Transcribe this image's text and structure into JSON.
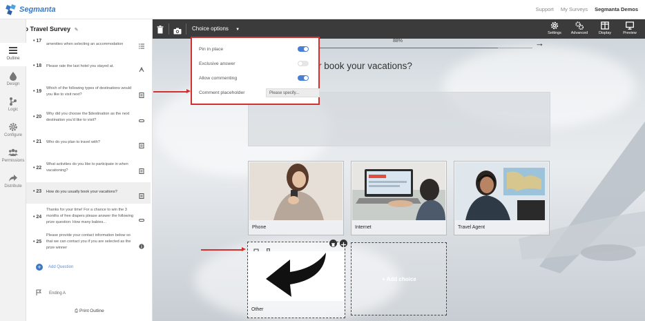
{
  "app": {
    "logo_text": "Segmanta",
    "nav": {
      "support": "Support",
      "my_surveys": "My Surveys",
      "account": "Segmanta Demos"
    }
  },
  "rail": [
    {
      "label": "Outline",
      "icon": "list-icon",
      "active": true
    },
    {
      "label": "Design",
      "icon": "drop-icon",
      "active": false
    },
    {
      "label": "Logic",
      "icon": "branch-icon",
      "active": false
    },
    {
      "label": "Configure",
      "icon": "gear-icon",
      "active": false
    },
    {
      "label": "Permissions",
      "icon": "users-icon",
      "active": false
    },
    {
      "label": "Distribute",
      "icon": "share-icon",
      "active": false
    }
  ],
  "outline": {
    "survey_title": "Demo Travel Survey",
    "questions": [
      {
        "num": "17",
        "text": "amenities when selecting an accommodation",
        "icon": "list-icon"
      },
      {
        "num": "18",
        "text": "Please rate the last hotel you stayed at.",
        "icon": "rating-icon"
      },
      {
        "num": "19",
        "text": "Which of the following types of destinations would you like to visit next?",
        "icon": "choice-icon"
      },
      {
        "num": "20",
        "text": "Why did you choose the $destination as the next destination you'd like to visit?",
        "icon": "text-icon"
      },
      {
        "num": "21",
        "text": "Who do you plan to travel with?",
        "icon": "choice-icon"
      },
      {
        "num": "22",
        "text": "What activities do you like to participate in when vacationing?",
        "icon": "choice-icon"
      },
      {
        "num": "23",
        "text": "How do you usually book your vacations?",
        "icon": "choice-icon",
        "active": true
      },
      {
        "num": "24",
        "text": "Thanks for your time! For a chance to win the 3 months of free diapers please answer the following prize question: How many babies...",
        "icon": "text-icon"
      },
      {
        "num": "25",
        "text": "Please provide your contact information below so that we can contact you if you are selected as the prize winner",
        "icon": "info-icon"
      }
    ],
    "add_question": "Add Question",
    "ending": "Ending A",
    "print_outline": "Print Outline"
  },
  "toolbar": {
    "choice_options": "Choice options",
    "right_buttons": [
      {
        "label": "Settings",
        "icon": "gear-icon"
      },
      {
        "label": "Advanced",
        "icon": "gears-icon"
      },
      {
        "label": "Display",
        "icon": "layout-icon"
      },
      {
        "label": "Preview",
        "icon": "monitor-icon"
      }
    ]
  },
  "canvas": {
    "progress_text": "88%",
    "progress": 0.88,
    "question_visible_text": "r book your vacations?",
    "choices": [
      {
        "label": "Phone"
      },
      {
        "label": "Internet"
      },
      {
        "label": "Travel Agent"
      },
      {
        "label": "Other"
      }
    ],
    "add_choice": "+ Add choice"
  },
  "popup": {
    "options": [
      {
        "label": "Pin in place",
        "on": true
      },
      {
        "label": "Exclusive answer",
        "on": false
      },
      {
        "label": "Allow commenting",
        "on": true
      }
    ],
    "comment_placeholder_label": "Comment placeholder",
    "comment_placeholder_value": "Please specify..."
  },
  "colors": {
    "accent": "#3a78c4",
    "toggle_on": "#4a7fd6",
    "toggle_off": "#e6e6e6",
    "highlight": "#d32f2f",
    "toolbar": "#3b3b3b"
  }
}
